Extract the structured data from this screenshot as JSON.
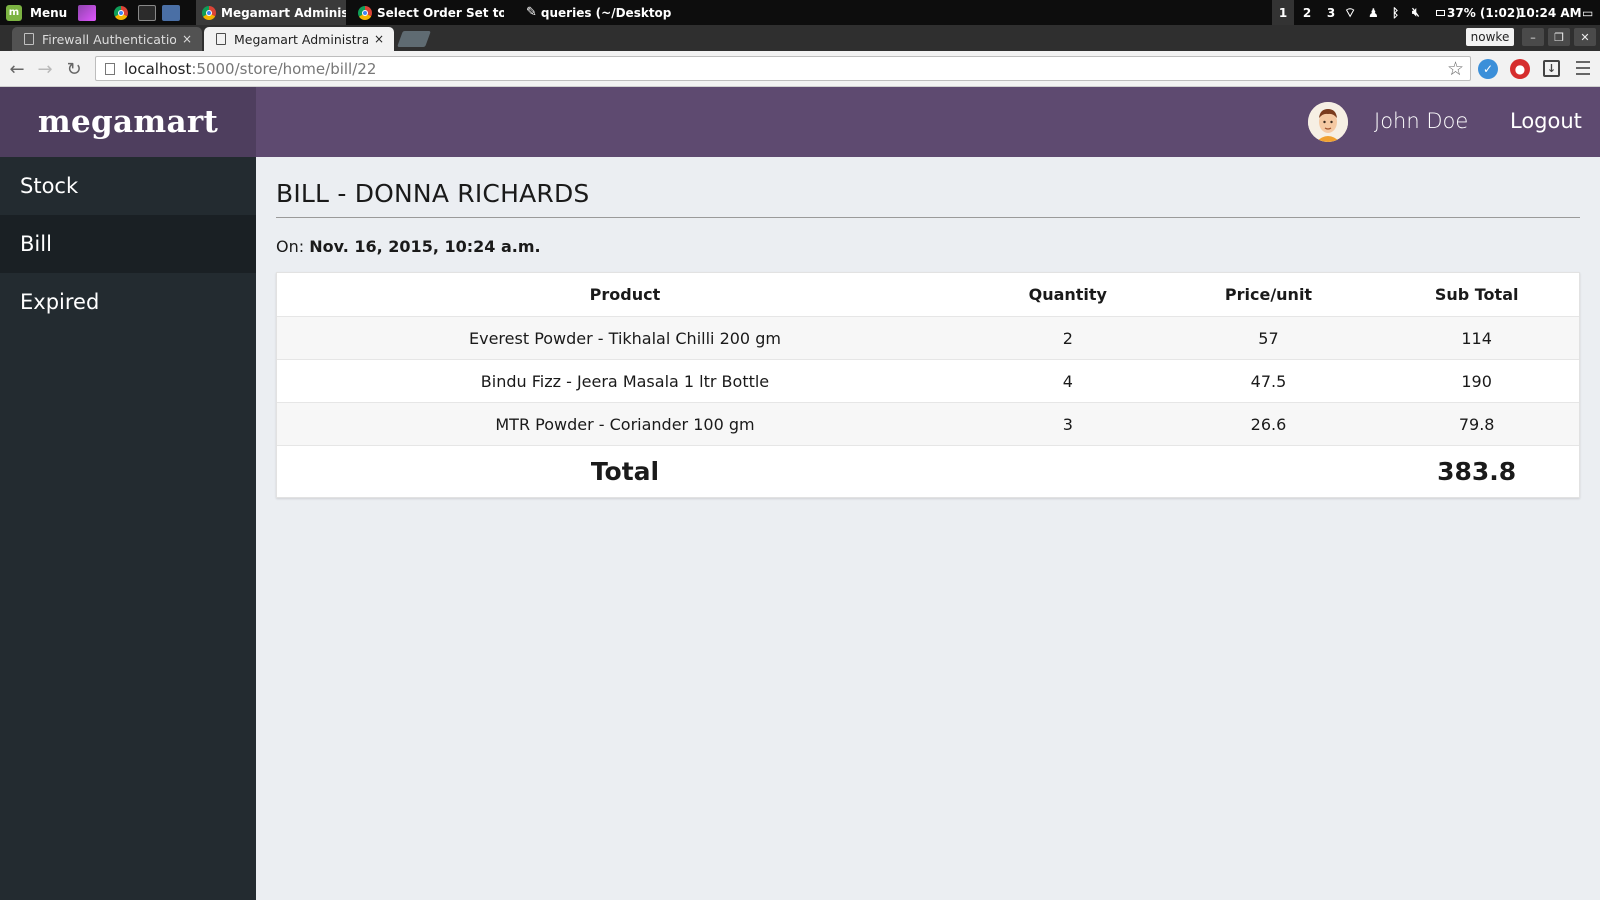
{
  "os_panel": {
    "menu_label": "Menu",
    "tasks": [
      {
        "label": "Megamart Administ..."
      },
      {
        "label": "Select Order Set to c..."
      },
      {
        "label": "queries (~/Desktop) ..."
      }
    ],
    "workspaces": [
      "1",
      "2",
      "3"
    ],
    "battery": "37% (1:02)",
    "clock": "10:24 AM"
  },
  "browser": {
    "tabs": [
      {
        "title": "Firewall Authentication",
        "active": false
      },
      {
        "title": "Megamart Administratio",
        "active": true
      }
    ],
    "profile": "nowke",
    "url_host": "localhost",
    "url_path": ":5000/store/home/bill/22",
    "colors": {
      "ext_blue": "#3b8fd9",
      "ext_red": "#d62d2d"
    }
  },
  "app": {
    "brand": "megamart",
    "user": {
      "name": "John Doe"
    },
    "logout_label": "Logout",
    "colors": {
      "brand_bar": "#4e3e5e",
      "topbar": "#5e4a70",
      "sidebar": "#232b30",
      "content_bg": "#ebeef2"
    },
    "sidebar": {
      "items": [
        {
          "label": "Stock",
          "active": false
        },
        {
          "label": "Bill",
          "active": true
        },
        {
          "label": "Expired",
          "active": false
        }
      ]
    },
    "bill": {
      "title": "BILL - DONNA RICHARDS",
      "date_prefix": "On:",
      "date": "Nov. 16, 2015, 10:24 a.m.",
      "columns": [
        "Product",
        "Quantity",
        "Price/unit",
        "Sub Total"
      ],
      "rows": [
        {
          "product": "Everest Powder - Tikhalal Chilli 200 gm",
          "quantity": "2",
          "price": "57",
          "subtotal": "114"
        },
        {
          "product": "Bindu Fizz - Jeera Masala 1 ltr Bottle",
          "quantity": "4",
          "price": "47.5",
          "subtotal": "190"
        },
        {
          "product": "MTR Powder - Coriander 100 gm",
          "quantity": "3",
          "price": "26.6",
          "subtotal": "79.8"
        }
      ],
      "total_label": "Total",
      "total_value": "383.8"
    }
  }
}
